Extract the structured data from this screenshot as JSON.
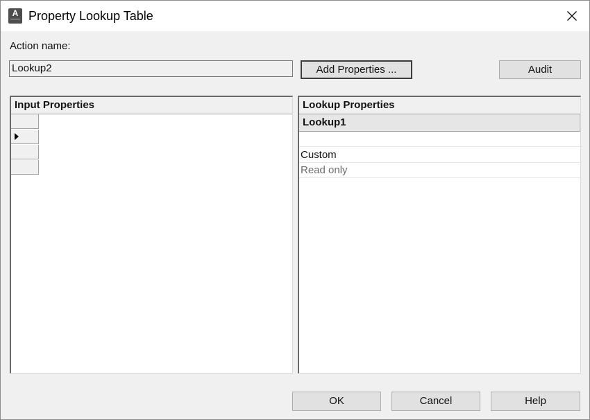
{
  "window": {
    "title": "Property Lookup Table",
    "icon": "autocad-app-icon",
    "icon_letter": "A",
    "close_icon": "close-icon"
  },
  "action": {
    "label": "Action name:",
    "value": "Lookup2"
  },
  "buttons": {
    "add_properties": "Add Properties ...",
    "audit": "Audit",
    "ok": "OK",
    "cancel": "Cancel",
    "help": "Help"
  },
  "input_panel": {
    "header": "Input Properties",
    "row_count": 4,
    "current_row": 2
  },
  "lookup_panel": {
    "header": "Lookup Properties",
    "column": "Lookup1",
    "rows": [
      "",
      "Custom",
      "Read only"
    ]
  }
}
